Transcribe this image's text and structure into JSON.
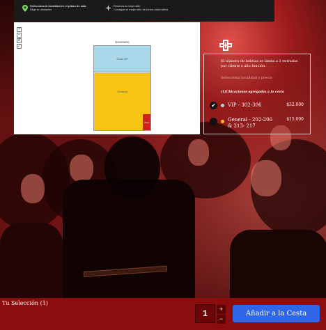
{
  "topbar": {
    "item1_line1": "Selecciona la localidad en el plano de sala",
    "item1_line2": "Elige tu ubicación",
    "item1_icon": "map-pin-icon",
    "item2_line1": "Reserva el mejor sitio",
    "item2_line2": "Consigue el mejor sitio de forma automática",
    "item2_icon": "sparkle-icon"
  },
  "map": {
    "zoom_controls": [
      "+",
      "−",
      "⊙",
      "⤢"
    ],
    "stage_label": "Escenario",
    "zone_vip": "Zona VIP",
    "zone_general": "General",
    "zone_small": "Zona"
  },
  "info": {
    "notice_line1": "El número de boletas se limita a 3 entradas",
    "notice_line2": "por cliente o año función.",
    "select_label": "Selecciona localidad y precio",
    "seats_label": "(1)Ubicaciones agregadas a la cesta",
    "rows": [
      {
        "name": "VIP - 302-306",
        "name2": "",
        "price": "$32.000",
        "dot_color": "#a9d8ea",
        "checked": true
      },
      {
        "name": "General - 202-206",
        "name2": "& 213- 217",
        "price": "$15.000",
        "dot_color": "#f7c413",
        "checked": false
      }
    ]
  },
  "bottom": {
    "selection_label": "Tu Selección (1)",
    "quantity": "1",
    "plus": "+",
    "minus": "−",
    "add_button": "Añadir a la Cesta"
  },
  "colors": {
    "bottombar": "#8c0d0d",
    "add_button": "#2f66e8",
    "vip": "#a9d8ea",
    "general": "#f7c413"
  }
}
